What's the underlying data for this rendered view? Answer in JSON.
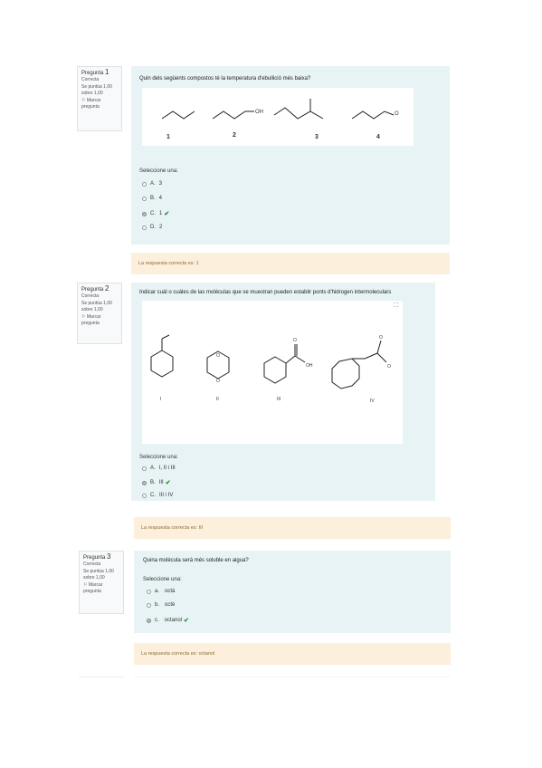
{
  "questions": [
    {
      "label": "Pregunta",
      "number": "1",
      "state": "Correcta",
      "score": "Se puntúa 1,00 sobre 1,00",
      "flag": "Marcar pregunta",
      "text": "Quin dels següents compostos té la temperatura d'ebullició més baixa?",
      "figure_labels": [
        "1",
        "2",
        "3",
        "4"
      ],
      "oh_label": "OH",
      "o_label": "O",
      "prompt": "Seleccione una:",
      "options": [
        {
          "letter": "A.",
          "text": "3",
          "selected": false,
          "correct": false
        },
        {
          "letter": "B.",
          "text": "4",
          "selected": false,
          "correct": false
        },
        {
          "letter": "C.",
          "text": "1",
          "selected": true,
          "correct": true
        },
        {
          "letter": "D.",
          "text": "2",
          "selected": false,
          "correct": false
        }
      ],
      "feedback": "La respuesta correcta es: 1"
    },
    {
      "label": "Pregunta",
      "number": "2",
      "state": "Correcta",
      "score": "Se puntúa 1,00 sobre 1,00",
      "flag": "Marcar pregunta",
      "text": "Indicar cuál o cuáles de las moléculas que se muestran pueden establir ponts d'hidrogen intermoleculars",
      "figure_labels": [
        "I",
        "II",
        "III",
        "IV"
      ],
      "oh_label": "OH",
      "o_label": "O",
      "prompt": "Seleccione una:",
      "options": [
        {
          "letter": "A.",
          "text": "I, II i III",
          "selected": false,
          "correct": false
        },
        {
          "letter": "B.",
          "text": "III",
          "selected": true,
          "correct": true
        },
        {
          "letter": "C.",
          "text": "III i IV",
          "selected": false,
          "correct": false
        }
      ],
      "feedback": "La respuesta correcta es: III"
    },
    {
      "label": "Pregunta",
      "number": "3",
      "state": "Correcta",
      "score": "Se puntúa 1,00 sobre 1,00",
      "flag": "Marcar pregunta",
      "text": "Quina molècula serà més soluble en aigua?",
      "prompt": "Seleccione una:",
      "options": [
        {
          "letter": "a.",
          "text": "octà",
          "selected": false,
          "correct": false
        },
        {
          "letter": "b.",
          "text": "octè",
          "selected": false,
          "correct": false
        },
        {
          "letter": "c.",
          "text": "octanol",
          "selected": true,
          "correct": true
        }
      ],
      "feedback": "La respuesta correcta es: octanol"
    }
  ],
  "colors": {
    "content_bg": "#e7f3f5",
    "feedback_bg": "#fcefdc",
    "feedback_text": "#8a6d3b",
    "check": "#2e8b3a"
  },
  "icons": [
    "flag-icon",
    "expand-icon",
    "check-icon",
    "radio-icon"
  ]
}
